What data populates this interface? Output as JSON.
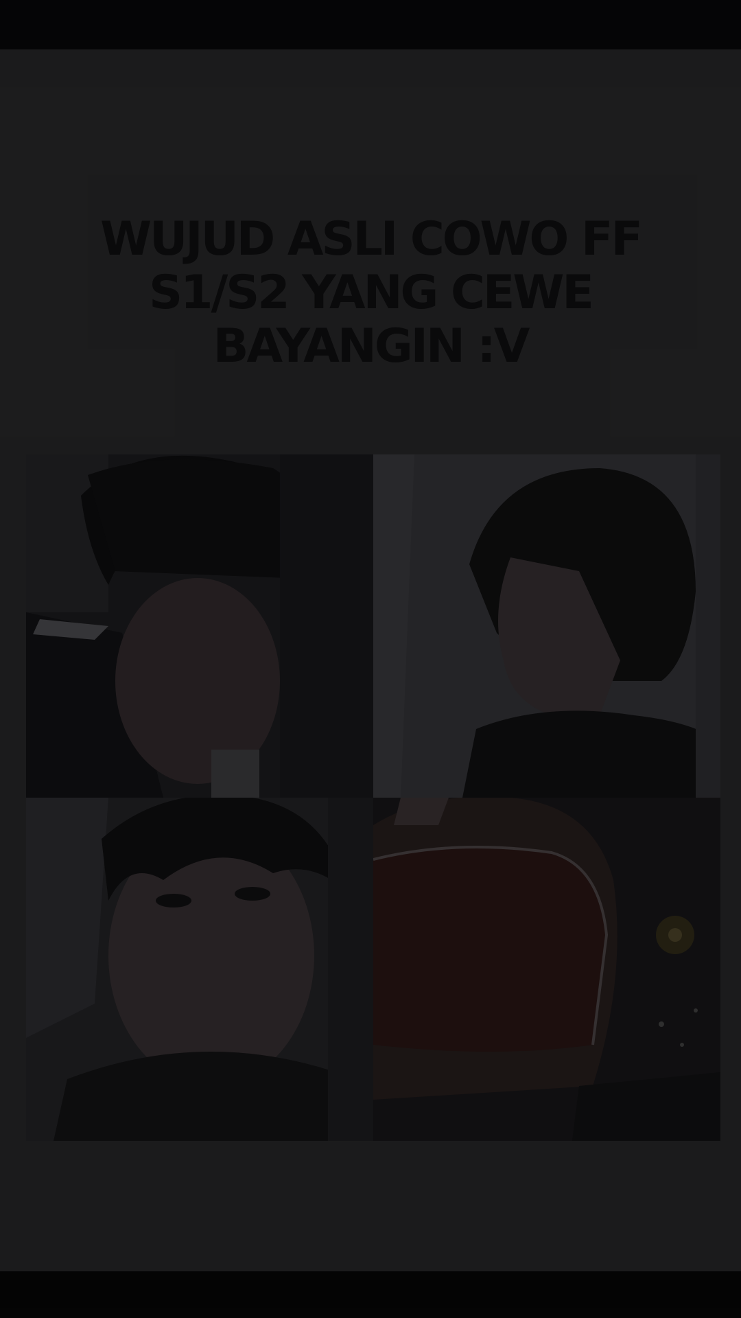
{
  "post": {
    "caption": "WUJUD ASLI COWO FF S1/S2 YANG CEWE BAYANGIN :V"
  },
  "collage": {
    "photos": [
      {
        "subject": "boy-selfie-portrait"
      },
      {
        "subject": "boy-side-profile-portrait"
      },
      {
        "subject": "boy-closeup-portrait"
      },
      {
        "subject": "motorcycle-helmet-night"
      }
    ]
  },
  "colors": {
    "background": "#060607",
    "card": "#1e1e1f",
    "caption_text": "#0b0b0c"
  }
}
